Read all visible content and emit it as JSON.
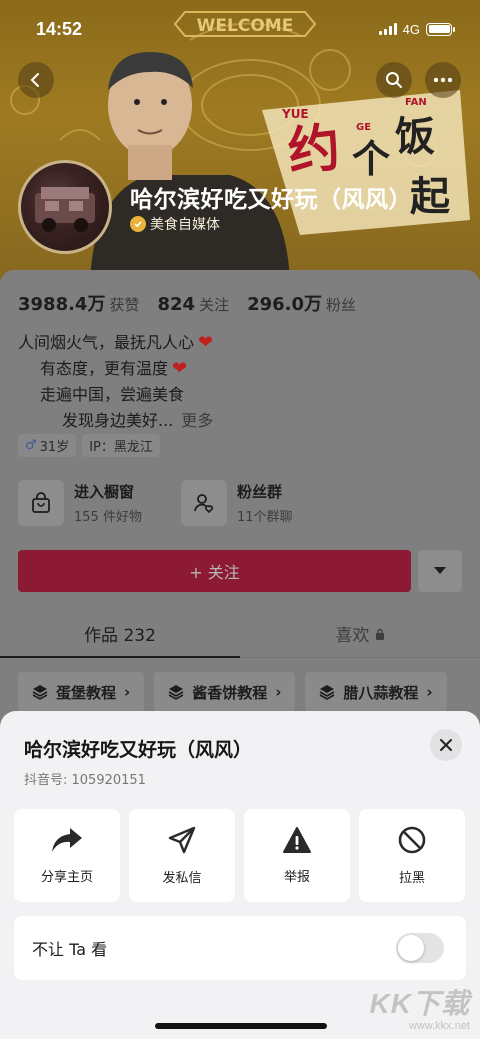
{
  "status_bar": {
    "time": "14:52",
    "network": "4G"
  },
  "banner": {
    "welcome_text": "WELCOME",
    "logo_main": "约个饭起",
    "logo_letters": [
      "YUE",
      "GE",
      "FAN"
    ]
  },
  "profile": {
    "name": "哈尔滨好吃又好玩（风风）",
    "verification": "美食自媒体",
    "stats": [
      {
        "value": "3988.4万",
        "label": "获赞"
      },
      {
        "value": "824",
        "label": "关注"
      },
      {
        "value": "296.0万",
        "label": "粉丝"
      }
    ],
    "bio_lines": [
      "人间烟火气，最抚凡人心",
      "有态度，更有温度",
      "走遍中国，尝遍美食",
      "发现身边美好..."
    ],
    "bio_more": "更多",
    "tags": [
      {
        "icon": "male-icon",
        "text": "31岁"
      },
      {
        "icon": "",
        "text": "IP：黑龙江"
      }
    ],
    "shop_entries": [
      {
        "title": "进入橱窗",
        "subtitle": "155 件好物",
        "icon": "bag-icon"
      },
      {
        "title": "粉丝群",
        "subtitle": "11个群聊",
        "icon": "group-icon"
      }
    ],
    "follow_label": "+ 关注",
    "tabs": [
      {
        "label": "作品 232",
        "active": true
      },
      {
        "label": "喜欢",
        "locked": true
      }
    ],
    "collections": [
      "蛋堡教程",
      "酱香饼教程",
      "腊八蒜教程"
    ]
  },
  "sheet": {
    "title": "哈尔滨好吃又好玩（风风）",
    "douyin_id": "抖音号: 105920151",
    "actions": [
      {
        "label": "分享主页",
        "icon": "share-icon"
      },
      {
        "label": "发私信",
        "icon": "send-message-icon"
      },
      {
        "label": "举报",
        "icon": "report-warning-icon"
      },
      {
        "label": "拉黑",
        "icon": "block-icon"
      }
    ],
    "toggle_label": "不让 Ta 看",
    "toggle_on": false
  },
  "watermark": {
    "big": "KK下载",
    "small": "www.kkx.net"
  },
  "colors": {
    "banner": "#9e7a22",
    "follow": "#8c1a34",
    "sheet_bg": "#f2f2f4",
    "heart": "#c02020"
  }
}
